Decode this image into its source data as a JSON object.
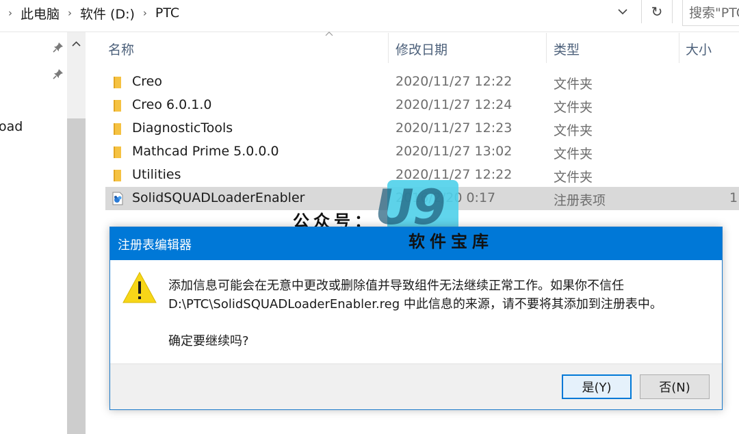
{
  "address_bar": {
    "breadcrumbs": [
      "此电脑",
      "软件 (D:)",
      "PTC"
    ],
    "search_placeholder": "搜索\"PTC\""
  },
  "nav_pane": {
    "partial_item": "oad"
  },
  "columns": {
    "name": "名称",
    "date": "修改日期",
    "type": "类型",
    "size": "大小"
  },
  "files": [
    {
      "name": "Creo",
      "date": "2020/11/27 12:22",
      "type": "文件夹",
      "size": "",
      "icon": "folder-icon"
    },
    {
      "name": "Creo 6.0.1.0",
      "date": "2020/11/27 12:24",
      "type": "文件夹",
      "size": "",
      "icon": "folder-icon"
    },
    {
      "name": "DiagnosticTools",
      "date": "2020/11/27 12:23",
      "type": "文件夹",
      "size": "",
      "icon": "folder-icon"
    },
    {
      "name": "Mathcad Prime 5.0.0.0",
      "date": "2020/11/27 13:02",
      "type": "文件夹",
      "size": "",
      "icon": "folder-icon"
    },
    {
      "name": "Utilities",
      "date": "2020/11/27 12:22",
      "type": "文件夹",
      "size": "",
      "icon": "folder-icon"
    },
    {
      "name": "SolidSQUADLoaderEnabler",
      "date": "2016/2/20 0:17",
      "type": "注册表项",
      "size": "1",
      "icon": "registry-file-icon"
    }
  ],
  "watermark": {
    "prefix": "公众号：",
    "logo": "U9",
    "subtitle": "软件宝库"
  },
  "dialog": {
    "title": "注册表编辑器",
    "message_line1": "添加信息可能会在无意中更改或删除值并导致组件无法继续正常工作。如果你不信任",
    "message_line2": "D:\\PTC\\SolidSQUADLoaderEnabler.reg 中此信息的来源，请不要将其添加到注册表中。",
    "question": "确定要继续吗?",
    "yes_label": "是(Y)",
    "no_label": "否(N)"
  },
  "colors": {
    "accent": "#0078d7",
    "selection": "#d9d9d9",
    "folder": "#f5c242",
    "warning": "#f7d618"
  }
}
